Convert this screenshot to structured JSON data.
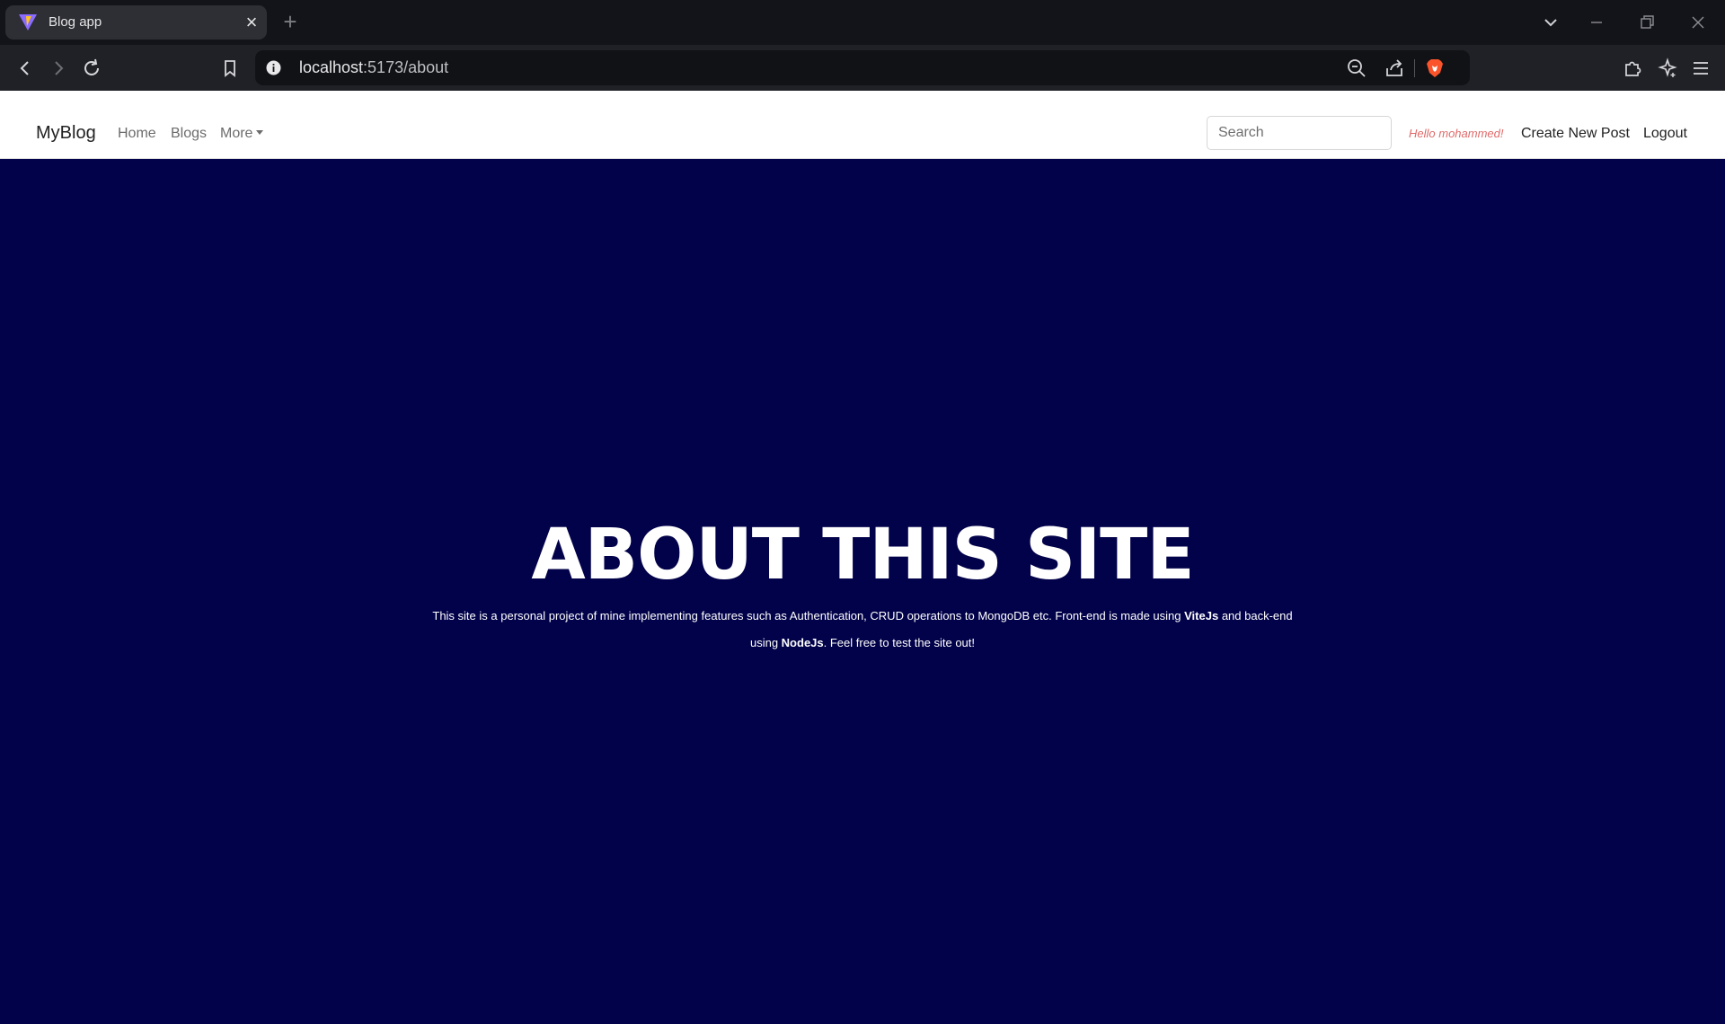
{
  "browser": {
    "tab_title": "Blog app",
    "url_host": "localhost",
    "url_path": ":5173/about"
  },
  "navbar": {
    "brand": "MyBlog",
    "links": [
      "Home",
      "Blogs",
      "More"
    ],
    "search_placeholder": "Search",
    "greeting": "Hello mohammed!",
    "create_label": "Create New Post",
    "logout_label": "Logout"
  },
  "hero": {
    "title": "ABOUT THIS SITE",
    "text_part1": "This site is a personal project of mine implementing features such as Authentication, CRUD operations to MongoDB etc. Front-end is made using ",
    "frontend_tech": "ViteJs",
    "text_part2": " and back-end using ",
    "backend_tech": "NodeJs",
    "text_part3": ". Feel free to test the site out!"
  },
  "colors": {
    "hero_background": "#02024a",
    "greeting": "#e06a6a",
    "brave_shield": "#fb542b"
  }
}
